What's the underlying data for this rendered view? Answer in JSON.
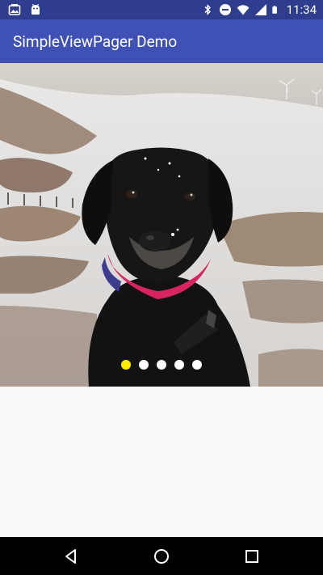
{
  "status_bar": {
    "time": "11:34",
    "left_icons": [
      "image-notification-icon",
      "android-notification-icon"
    ],
    "right_icons": [
      "bluetooth-icon",
      "do-not-disturb-icon",
      "wifi-icon",
      "signal-icon",
      "battery-icon"
    ]
  },
  "app_bar": {
    "title": "SimpleViewPager Demo",
    "color": "#3f51b5"
  },
  "pager": {
    "page_count": 5,
    "current_page": 1,
    "image_subject": "black-labrador-in-snowy-field",
    "indicator_active_color": "#ffeb00",
    "indicator_inactive_color": "#ffffff"
  },
  "nav_bar": {
    "buttons": [
      "back-icon",
      "home-icon",
      "recents-icon"
    ]
  }
}
